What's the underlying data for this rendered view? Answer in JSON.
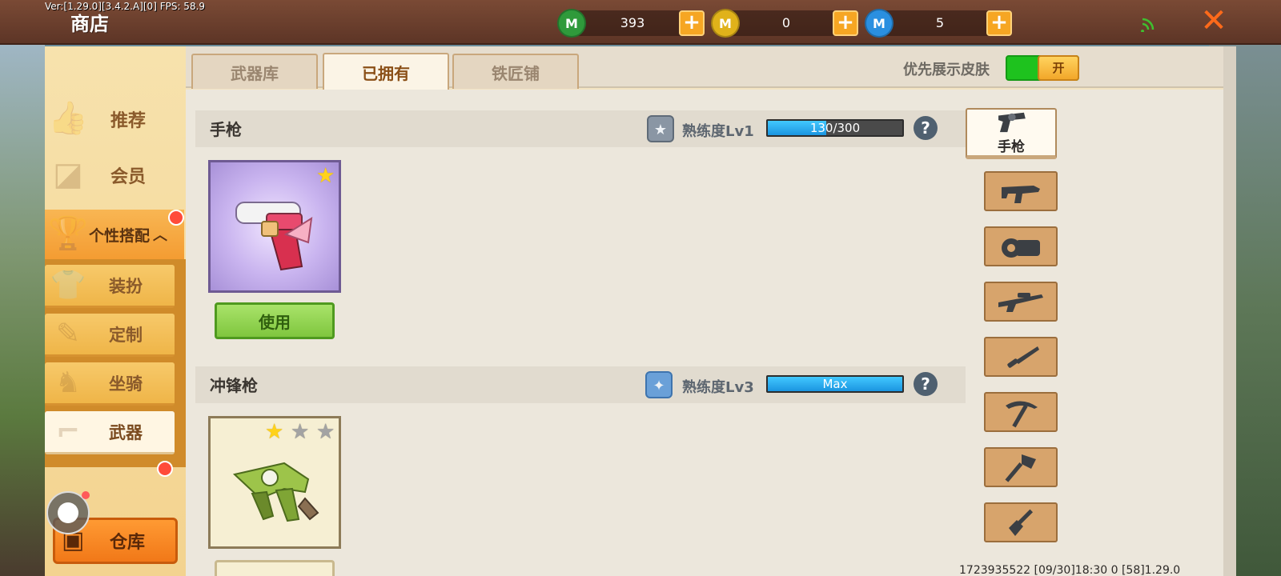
{
  "debug_text": "Ver:[1.29.0][3.4.2.A][0] FPS: 58.9",
  "header": {
    "title": "商店",
    "currencies": [
      {
        "icon": "green-gem-icon",
        "amount": "393",
        "color": "#2f9a3b"
      },
      {
        "icon": "gold-coin-icon",
        "amount": "0",
        "color": "#e0b21a"
      },
      {
        "icon": "blue-coin-icon",
        "amount": "5",
        "color": "#2a8fe0"
      }
    ],
    "close_icon": "close-icon"
  },
  "sidebar": {
    "items": [
      {
        "label": "推荐",
        "icon": "thumbs-up-icon"
      },
      {
        "label": "会员",
        "icon": "member-icon"
      },
      {
        "label": "个性搭配",
        "icon": "trophy-icon",
        "expanded": true
      },
      {
        "label": "装扮",
        "icon": "shirt-icon"
      },
      {
        "label": "定制",
        "icon": "pencil-icon"
      },
      {
        "label": "坐骑",
        "icon": "mount-icon"
      },
      {
        "label": "武器",
        "icon": "revolver-icon",
        "active": true
      }
    ],
    "warehouse_label": "仓库"
  },
  "tabs": [
    {
      "label": "武器库",
      "active": false
    },
    {
      "label": "已拥有",
      "active": true
    },
    {
      "label": "铁匠铺",
      "active": false
    }
  ],
  "skin_toggle": {
    "label": "优先展示皮肤",
    "state_label": "开"
  },
  "sections": [
    {
      "title": "手枪",
      "proficiency_label": "熟练度Lv1",
      "progress_text": "130/300",
      "progress_fraction": 0.433,
      "stars": [
        "gold"
      ],
      "button_label": "使用"
    },
    {
      "title": "冲锋枪",
      "proficiency_label": "熟练度Lv3",
      "progress_text": "Max",
      "progress_fraction": 1.0,
      "stars": [
        "gold",
        "grey",
        "grey"
      ]
    }
  ],
  "categories": [
    {
      "label": "手枪",
      "icon": "revolver-icon",
      "active": true
    },
    {
      "icon": "submachine-gun-icon"
    },
    {
      "icon": "gatling-gun-icon"
    },
    {
      "icon": "sniper-rifle-icon"
    },
    {
      "icon": "dagger-icon"
    },
    {
      "icon": "pickaxe-icon"
    },
    {
      "icon": "axe-icon"
    },
    {
      "icon": "shovel-icon"
    }
  ],
  "footer": "1723935522  [09/30]18:30 0  [58]1.29.0"
}
